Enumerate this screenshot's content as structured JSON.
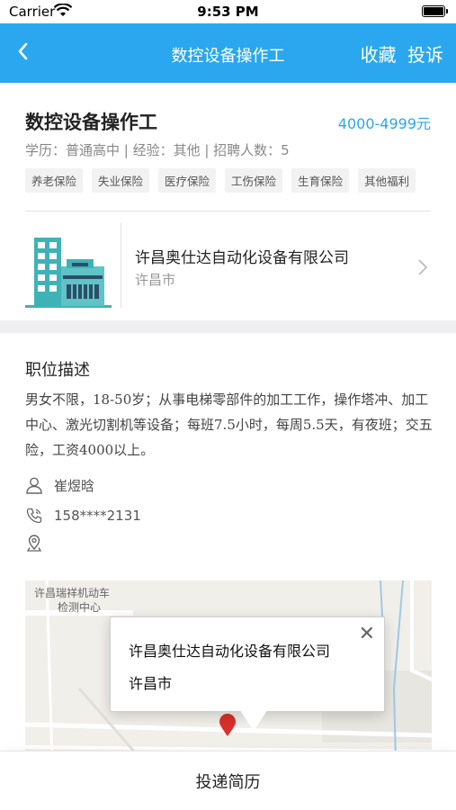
{
  "status_bar": {
    "carrier": "Carrier",
    "time": "9:53 PM"
  },
  "nav": {
    "title": "数控设备操作工",
    "favorite": "收藏",
    "report": "投诉"
  },
  "job": {
    "title": "数控设备操作工",
    "salary": "4000-4999元",
    "meta": "学历：普通高中 | 经验：其他 | 招聘人数：5",
    "tags": [
      "养老保险",
      "失业保险",
      "医疗保险",
      "工伤保险",
      "生育保险",
      "其他福利"
    ]
  },
  "company": {
    "name": "许昌奥仕达自动化设备有限公司",
    "city": "许昌市"
  },
  "description": {
    "title": "职位描述",
    "text": "男女不限，18-50岁；从事电梯零部件的加工工作，操作塔冲、加工中心、激光切割机等设备；每班7.5小时，每周5.5天，有夜班；交五险，工资4000以上。"
  },
  "contact": {
    "name": "崔煜晗",
    "phone": "158****2131",
    "address": ""
  },
  "map": {
    "poi_line1": "许昌瑞祥机动车",
    "poi_line2": "检测中心",
    "callout_name": "许昌奥仕达自动化设备有限公司",
    "callout_city": "许昌市"
  },
  "bottom": {
    "submit_label": "投递简历"
  },
  "colors": {
    "accent": "#2aa7ee",
    "pin": "#d9302a"
  },
  "icons": [
    "wifi-icon",
    "battery-icon",
    "back-arrow-icon",
    "building-icon",
    "chevron-right-icon",
    "person-icon",
    "phone-icon",
    "location-icon",
    "close-icon",
    "map-pin-icon"
  ]
}
